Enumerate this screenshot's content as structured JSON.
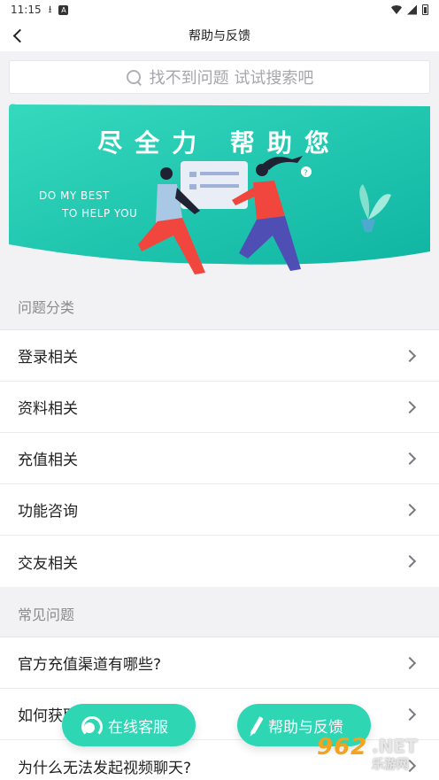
{
  "status_bar": {
    "time": "11:15"
  },
  "header": {
    "title": "帮助与反馈"
  },
  "search": {
    "placeholder": "找不到问题 试试搜索吧"
  },
  "banner": {
    "title": "尽全力 帮助您",
    "subtitle_line1": "DO MY BEST",
    "subtitle_line2": "TO HELP YOU"
  },
  "categories": {
    "label": "问题分类",
    "items": [
      {
        "label": "登录相关"
      },
      {
        "label": "资料相关"
      },
      {
        "label": "充值相关"
      },
      {
        "label": "功能咨询"
      },
      {
        "label": "交友相关"
      }
    ]
  },
  "faq": {
    "label": "常见问题",
    "items": [
      {
        "label": "官方充值渠道有哪些?"
      },
      {
        "label": "如何获取新用户?"
      },
      {
        "label": "为什么无法发起视频聊天?"
      }
    ]
  },
  "fab": {
    "service_label": "在线客服",
    "help_label": "帮助与反馈"
  },
  "watermark": {
    "number": "962",
    "domain": ".NET",
    "sub": "乐游网"
  },
  "colors": {
    "accent": "#2fd6b4",
    "banner_start": "#2ed3b7",
    "banner_end": "#0db8a6"
  }
}
